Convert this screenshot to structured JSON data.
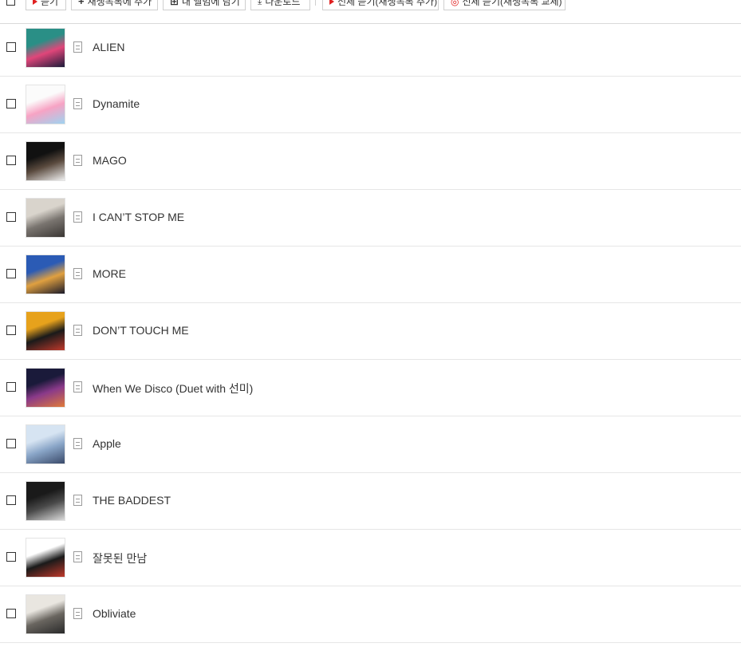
{
  "toolbar": {
    "buttons": [
      {
        "label": "듣기",
        "icon": "play-icon"
      },
      {
        "label": "재생목록에 추가",
        "icon": "plus-icon"
      },
      {
        "label": "내 앨범에 담기",
        "icon": "add-album-icon"
      },
      {
        "label": "다운로드",
        "icon": "download-icon"
      },
      {
        "label": "전체 듣기(재생목록 추가)",
        "icon": "play-icon"
      },
      {
        "label": "전체 듣기(재생목록 교체)",
        "icon": "replace-play-icon"
      }
    ]
  },
  "songs": [
    {
      "title": "ALIEN",
      "cover": [
        "#2a8f86",
        "#e0467a",
        "#1b1b3a"
      ]
    },
    {
      "title": "Dynamite",
      "cover": [
        "#fbfbfb",
        "#f7a3c4",
        "#9fd3f0"
      ]
    },
    {
      "title": "MAGO",
      "cover": [
        "#111111",
        "#5a4a3e",
        "#f0f0f0"
      ]
    },
    {
      "title": "I CAN’T STOP ME",
      "cover": [
        "#d9d4cc",
        "#7a7570",
        "#3a3633"
      ]
    },
    {
      "title": "MORE",
      "cover": [
        "#2b5bb5",
        "#e0a040",
        "#1a1a2a"
      ]
    },
    {
      "title": "DON’T TOUCH ME",
      "cover": [
        "#e7a21c",
        "#1a1a1a",
        "#c0392b"
      ]
    },
    {
      "title": "When We Disco (Duet with 선미)",
      "cover": [
        "#1a1a3a",
        "#8a3a8a",
        "#e07a3a"
      ]
    },
    {
      "title": "Apple",
      "cover": [
        "#d6e4f2",
        "#8aa6c8",
        "#3a4a6a"
      ]
    },
    {
      "title": "THE BADDEST",
      "cover": [
        "#1a1a1a",
        "#4a4a4a",
        "#dcdcdc"
      ]
    },
    {
      "title": "잘못된 만남",
      "cover": [
        "#ffffff",
        "#1a1a1a",
        "#c0392b"
      ]
    },
    {
      "title": "Obliviate",
      "cover": [
        "#e9e6e0",
        "#6a6660",
        "#2a2a2a"
      ]
    }
  ],
  "colors": {
    "accent": "#e02020",
    "divider": "#e6e6e6"
  }
}
